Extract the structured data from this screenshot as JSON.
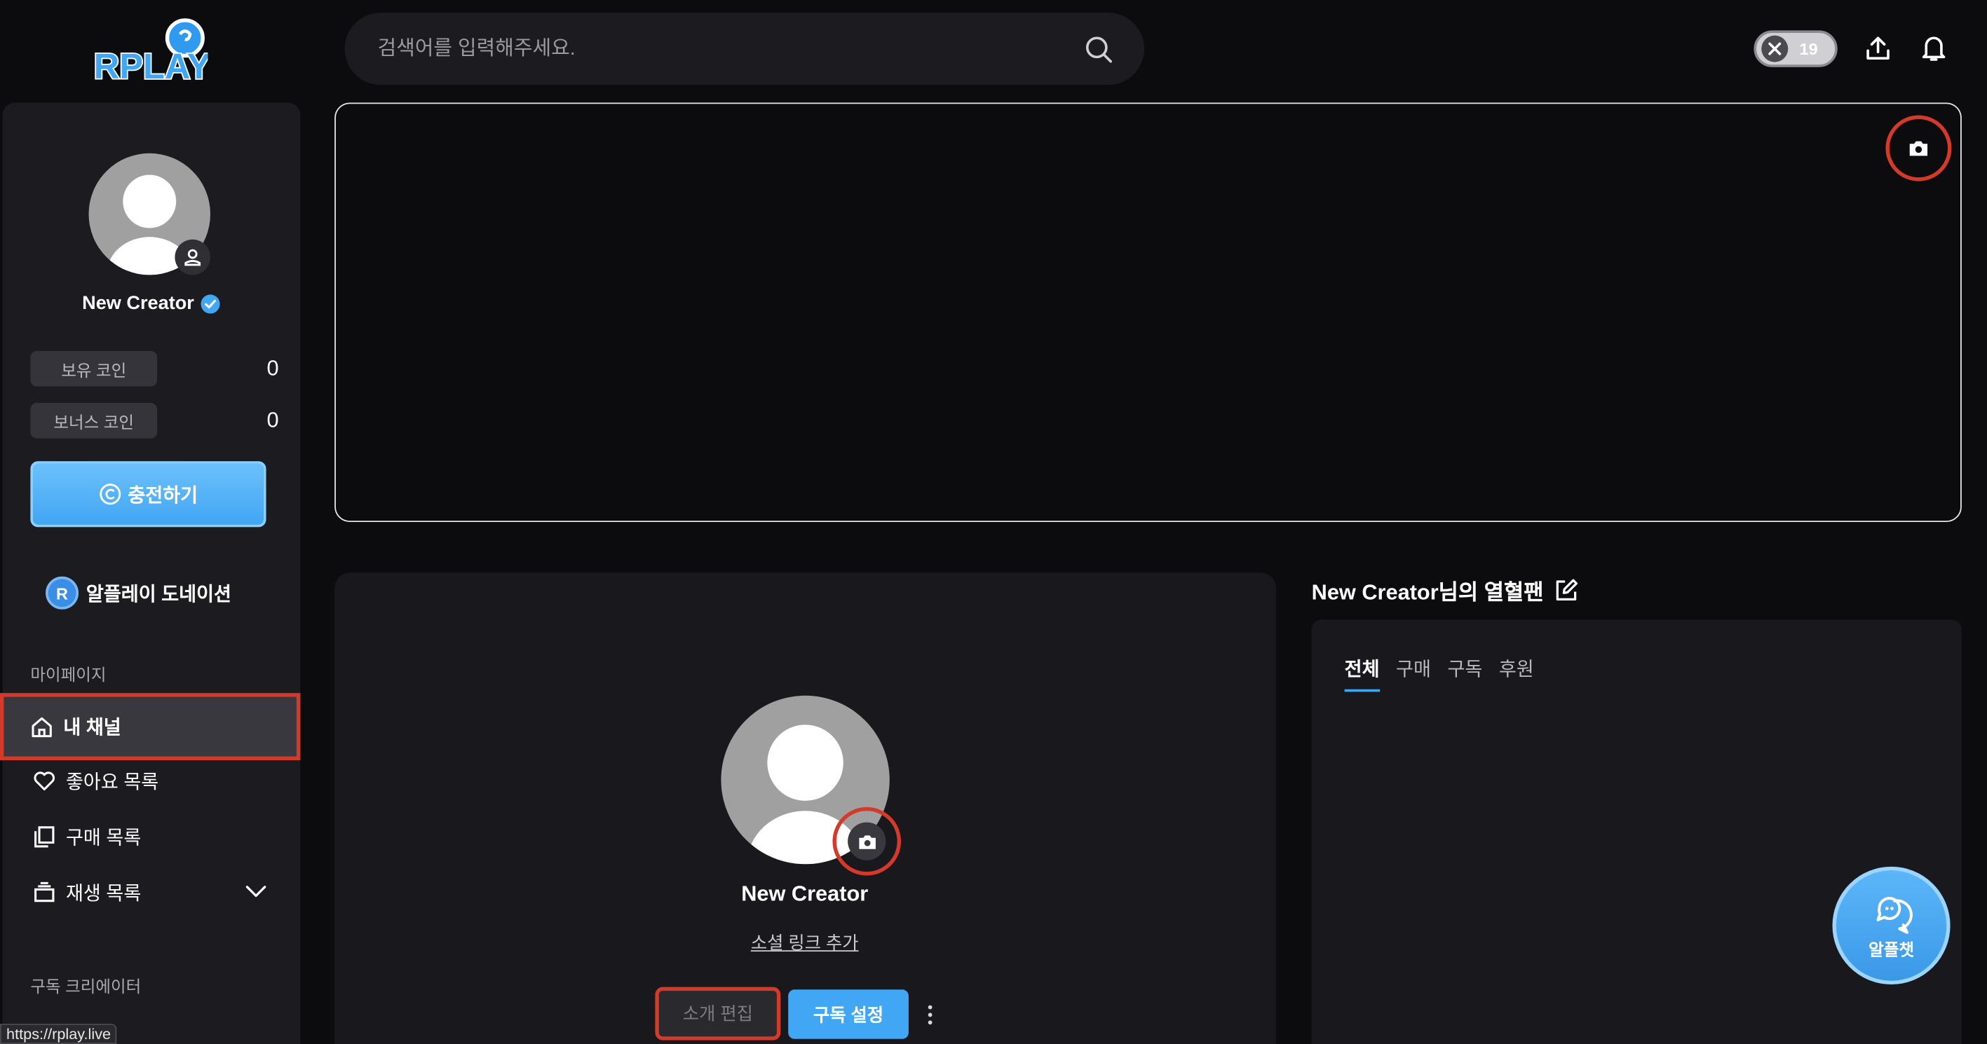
{
  "app": {
    "logo_text": "RPLAY"
  },
  "header": {
    "search_placeholder": "검색어를 입력해주세요.",
    "adult_badge": "19"
  },
  "sidebar": {
    "user_name": "New Creator",
    "coins": [
      {
        "label": "보유 코인",
        "value": "0"
      },
      {
        "label": "보너스 코인",
        "value": "0"
      }
    ],
    "charge_label": "충전하기",
    "donation_badge": "R",
    "donation_label": "알플레이 도네이션",
    "section_mypage": "마이페이지",
    "menu": [
      {
        "label": "내 채널"
      },
      {
        "label": "좋아요 목록"
      },
      {
        "label": "구매 목록"
      },
      {
        "label": "재생 목록"
      }
    ],
    "section_subscribed": "구독 크리에이터",
    "status_url": "https://rplay.live"
  },
  "profile": {
    "name": "New Creator",
    "social_link": "소셜 링크 추가",
    "edit_intro_label": "소개 편집",
    "subscribe_settings_label": "구독 설정"
  },
  "fans": {
    "title": "New Creator님의 열혈팬",
    "tabs": [
      "전체",
      "구매",
      "구독",
      "후원"
    ]
  },
  "chat_fab": {
    "label": "알플챗"
  },
  "colors": {
    "accent": "#41a6f4",
    "highlight": "#d33a2a",
    "panel": "#1c1c20",
    "background": "#0c0c0e"
  }
}
